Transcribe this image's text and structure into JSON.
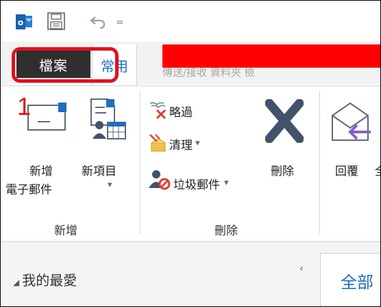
{
  "qat": {
    "app_icon": "outlook-icon",
    "save_icon": "save-icon",
    "undo_icon": "undo-icon",
    "more_glyph": "="
  },
  "tabs": {
    "file": "檔案",
    "home": "常用",
    "faint": "傳送/接收    資料夾    檢"
  },
  "annotation": {
    "step_number": "1",
    "color": "#e3101a"
  },
  "groups": {
    "new": {
      "label": "新增",
      "new_email_line1": "新增",
      "new_email_line2": "電子郵件",
      "new_items": "新項目",
      "new_items_dropdown": "▾"
    },
    "delete": {
      "label": "刪除",
      "ignore": "略過",
      "cleanup": "清理",
      "cleanup_dropdown": "▾",
      "junk": "垃圾郵件",
      "junk_dropdown": "▾",
      "delete_btn": "刪除"
    },
    "respond": {
      "reply": "回覆",
      "reply_all_partial": "全"
    }
  },
  "nav": {
    "favorites": "我的最愛",
    "favorites_expander": "◢",
    "collapse": "‹",
    "all_tab": "全部"
  },
  "colors": {
    "accent": "#1e6fbf",
    "file_tab_bg": "#2f2f2f",
    "redaction": "#ff0000"
  }
}
